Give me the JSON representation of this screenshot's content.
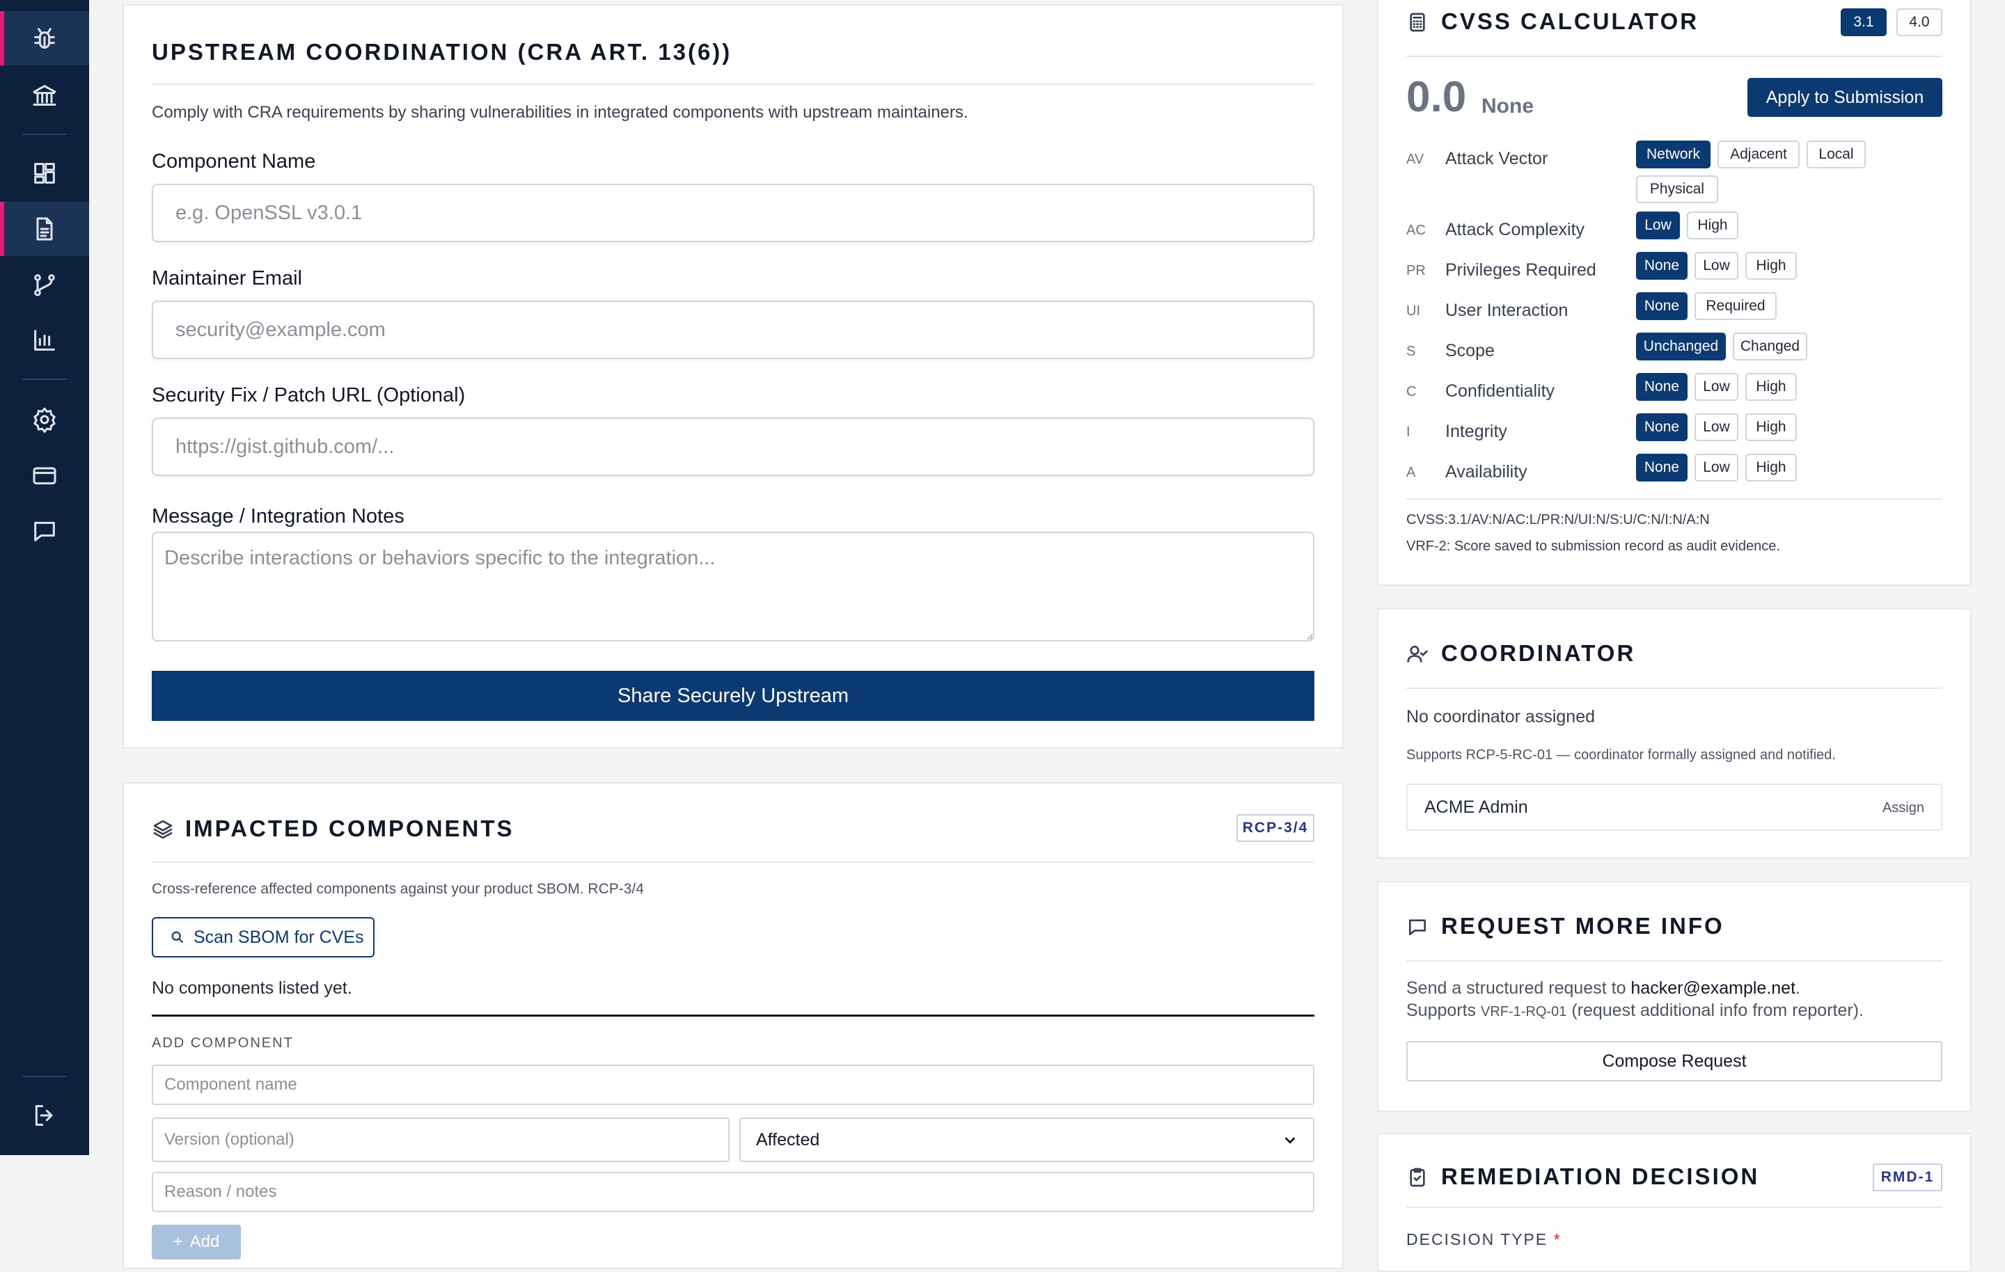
{
  "sidebar": {
    "items": [
      {
        "icon": "bug-icon",
        "active": true
      },
      {
        "icon": "bank-icon"
      },
      {
        "icon": "dashboard-icon"
      },
      {
        "icon": "document-icon",
        "active": true
      },
      {
        "icon": "branch-icon"
      },
      {
        "icon": "bar-chart-icon"
      },
      {
        "icon": "gear-icon"
      },
      {
        "icon": "credit-card-icon"
      },
      {
        "icon": "chat-icon"
      },
      {
        "icon": "logout-icon"
      }
    ]
  },
  "upstream": {
    "title": "UPSTREAM COORDINATION (CRA ART. 13(6))",
    "description": "Comply with CRA requirements by sharing vulnerabilities in integrated components with upstream maintainers.",
    "component_label": "Component Name",
    "component_placeholder": "e.g. OpenSSL v3.0.1",
    "email_label": "Maintainer Email",
    "email_placeholder": "security@example.com",
    "patch_label": "Security Fix / Patch URL (Optional)",
    "patch_placeholder": "https://gist.github.com/...",
    "notes_label": "Message / Integration Notes",
    "notes_placeholder": "Describe interactions or behaviors specific to the integration...",
    "share_button": "Share Securely Upstream"
  },
  "impacted": {
    "title": "IMPACTED COMPONENTS",
    "badge": "RCP-3/4",
    "description": "Cross-reference affected components against your product SBOM. RCP-3/4",
    "scan_button": "Scan SBOM for CVEs",
    "empty_text": "No components listed yet.",
    "add_heading": "ADD COMPONENT",
    "name_placeholder": "Component name",
    "version_placeholder": "Version (optional)",
    "status_selected": "Affected",
    "reason_placeholder": "Reason / notes",
    "add_button": "Add"
  },
  "cvss": {
    "title": "CVSS CALCULATOR",
    "versions": [
      "3.1",
      "4.0"
    ],
    "score": "0.0",
    "severity": "None",
    "apply_button": "Apply to Submission",
    "metrics": [
      {
        "abbr": "AV",
        "label": "Attack Vector",
        "options": [
          "Network",
          "Adjacent",
          "Local",
          "Physical"
        ],
        "selected": 0
      },
      {
        "abbr": "AC",
        "label": "Attack Complexity",
        "options": [
          "Low",
          "High"
        ],
        "selected": 0
      },
      {
        "abbr": "PR",
        "label": "Privileges Required",
        "options": [
          "None",
          "Low",
          "High"
        ],
        "selected": 0
      },
      {
        "abbr": "UI",
        "label": "User Interaction",
        "options": [
          "None",
          "Required"
        ],
        "selected": 0
      },
      {
        "abbr": "S",
        "label": "Scope",
        "options": [
          "Unchanged",
          "Changed"
        ],
        "selected": 0
      },
      {
        "abbr": "C",
        "label": "Confidentiality",
        "options": [
          "None",
          "Low",
          "High"
        ],
        "selected": 0
      },
      {
        "abbr": "I",
        "label": "Integrity",
        "options": [
          "None",
          "Low",
          "High"
        ],
        "selected": 0
      },
      {
        "abbr": "A",
        "label": "Availability",
        "options": [
          "None",
          "Low",
          "High"
        ],
        "selected": 0
      }
    ],
    "vector": "CVSS:3.1/AV:N/AC:L/PR:N/UI:N/S:U/C:N/I:N/A:N",
    "note": "VRF-2: Score saved to submission record as audit evidence."
  },
  "coordinator": {
    "title": "COORDINATOR",
    "status": "No coordinator assigned",
    "support_note": "Supports RCP-5-RC-01 — coordinator formally assigned and notified.",
    "assignee": "ACME Admin",
    "assign_link": "Assign"
  },
  "request_info": {
    "title": "REQUEST MORE INFO",
    "line1_prefix": "Send a structured request to ",
    "email": "hacker@example.net",
    "line1_suffix": ".",
    "line2_prefix": "Supports ",
    "code": "VRF-1-RQ-01",
    "line2_suffix": " (request additional info from reporter).",
    "button": "Compose Request"
  },
  "remediation": {
    "title": "REMEDIATION DECISION",
    "badge": "RMD-1",
    "decision_label": "DECISION TYPE",
    "required_mark": "*"
  },
  "colors": {
    "sidebar": "#0d213d",
    "accent": "#0b3a73",
    "active_marker": "#e11d74"
  }
}
